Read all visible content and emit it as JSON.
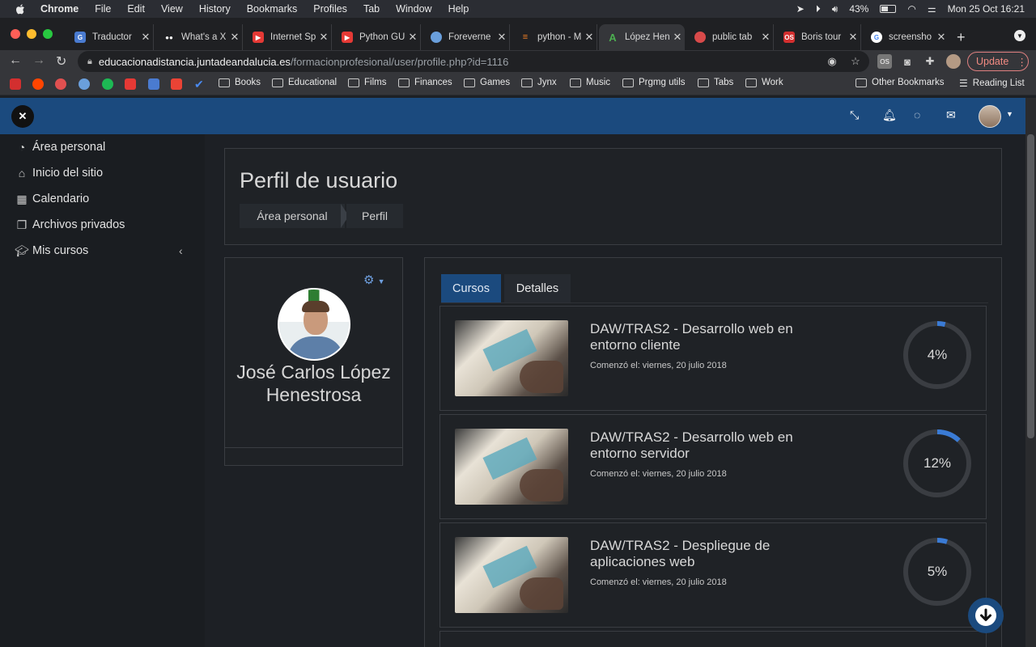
{
  "menubar": {
    "app": "Chrome",
    "items": [
      "File",
      "Edit",
      "View",
      "History",
      "Bookmarks",
      "Profiles",
      "Tab",
      "Window",
      "Help"
    ],
    "battery": "43%",
    "datetime": "Mon 25 Oct  16:21"
  },
  "tabs": [
    {
      "title": "Traductor",
      "icon": "translate-icon",
      "color": "#4a7bd0"
    },
    {
      "title": "What's a X",
      "icon": "medium-icon",
      "color": "#ffffff"
    },
    {
      "title": "Internet Sp",
      "icon": "youtube-icon",
      "color": "#e53935"
    },
    {
      "title": "Python GU",
      "icon": "youtube-icon",
      "color": "#e53935"
    },
    {
      "title": "Foreverne",
      "icon": "globe-icon",
      "color": "#6a9fdc"
    },
    {
      "title": "python - M",
      "icon": "stackoverflow-icon",
      "color": "#f48024"
    },
    {
      "title": "López Hen",
      "icon": "moodle-icon",
      "color": "#2e7d32"
    },
    {
      "title": "public tab",
      "icon": "record-icon",
      "color": "#d84a4a"
    },
    {
      "title": "Boris tour",
      "icon": "os-icon",
      "color": "#d32f2f"
    },
    {
      "title": "screensho",
      "icon": "google-icon",
      "color": "#ffffff"
    }
  ],
  "omnibox": {
    "host": "educacionadistancia.juntadeandalucia.es",
    "path": "/formacionprofesional/user/profile.php?id=1116"
  },
  "update_label": "Update",
  "bookmarks": {
    "folders": [
      "Books",
      "Educational",
      "Films",
      "Finances",
      "Games",
      "Jynx",
      "Music",
      "Prgmg utils",
      "Tabs",
      "Work"
    ],
    "other": "Other Bookmarks",
    "reading": "Reading List"
  },
  "sidebar": {
    "items": [
      {
        "label": "Área personal",
        "icon": "dashboard-icon"
      },
      {
        "label": "Inicio del sitio",
        "icon": "home-icon"
      },
      {
        "label": "Calendario",
        "icon": "calendar-icon"
      },
      {
        "label": "Archivos privados",
        "icon": "files-icon"
      },
      {
        "label": "Mis cursos",
        "icon": "graduation-cap-icon"
      }
    ]
  },
  "page": {
    "title": "Perfil de usuario",
    "breadcrumb": [
      "Área personal",
      "Perfil"
    ]
  },
  "profile": {
    "name": "José Carlos López Henestrosa"
  },
  "profile_tabs": [
    "Cursos",
    "Detalles"
  ],
  "courses": [
    {
      "title": "DAW/TRAS2 - Desarrollo web en entorno cliente",
      "started": "Comenzó el: viernes, 20 julio 2018",
      "progress": 4,
      "progress_label": "4%"
    },
    {
      "title": "DAW/TRAS2 - Desarrollo web en entorno servidor",
      "started": "Comenzó el: viernes, 20 julio 2018",
      "progress": 12,
      "progress_label": "12%"
    },
    {
      "title": "DAW/TRAS2 - Despliegue de aplicaciones web",
      "started": "Comenzó el: viernes, 20 julio 2018",
      "progress": 5,
      "progress_label": "5%"
    }
  ],
  "colors": {
    "header": "#1b4a7e",
    "accent": "#3a7bd5",
    "track": "#3a3d42"
  }
}
